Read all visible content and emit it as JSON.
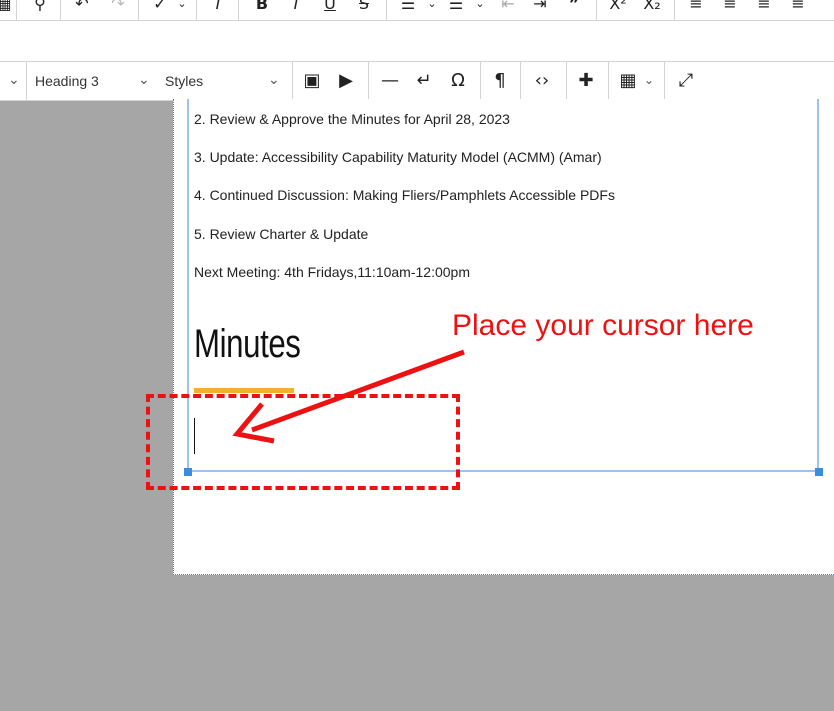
{
  "toolbar_top": {
    "icons": [
      "table-icon",
      "search-icon",
      "undo-icon",
      "redo-icon",
      "spellcheck-icon",
      "clear-format-icon",
      "bold-icon",
      "italic-icon",
      "underline-icon",
      "strikethrough-icon",
      "bullet-list-icon",
      "numbered-list-icon",
      "outdent-icon",
      "indent-icon",
      "blockquote-icon",
      "superscript-icon",
      "subscript-icon",
      "align-left-icon",
      "align-center-icon",
      "align-right-icon",
      "justify-icon"
    ]
  },
  "toolbar_format": {
    "heading_value": "Heading 3",
    "styles_value": "Styles",
    "icons": [
      "image-icon",
      "media-icon",
      "horizontal-line-icon",
      "line-break-icon",
      "special-char-icon",
      "show-blocks-icon",
      "source-code-icon",
      "plugin-icon",
      "table-icon",
      "fullscreen-icon"
    ]
  },
  "document": {
    "lines": [
      "2. Review & Approve the Minutes for April 28, 2023",
      "3. Update: Accessibility Capability Maturity Model (ACMM) (Amar)",
      "4. Continued Discussion: Making Fliers/Pamphlets Accessible PDFs",
      "5. Review Charter & Update",
      "Next Meeting: 4th Fridays,11:10am-12:00pm"
    ],
    "heading": "Minutes"
  },
  "annotation": {
    "callout": "Place your cursor here",
    "color": "#ee1111"
  }
}
